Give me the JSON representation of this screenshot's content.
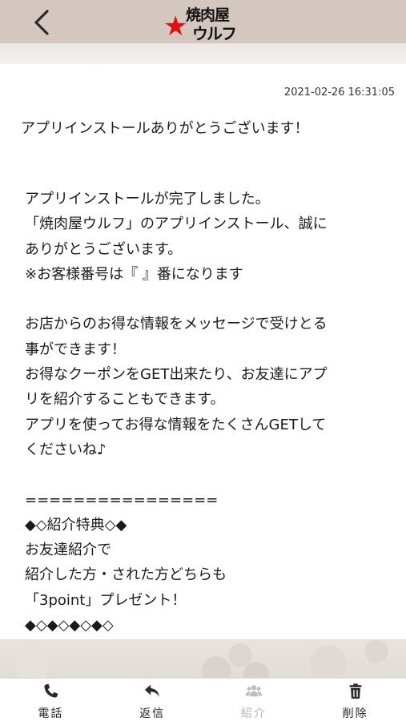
{
  "header": {
    "back_icon": "chevron-left-icon",
    "logo_top": "焼肉屋",
    "logo_bottom": "ウルフ",
    "logo_star": "★",
    "background": "#d4c7bf",
    "star_color": "#e01010"
  },
  "message": {
    "timestamp": "2021-02-26 16:31:05",
    "subject": "アプリインストールありがとうございます！",
    "lines": [
      "アプリインストールが完了しました。",
      "「焼肉屋ウルフ」のアプリインストール、誠に",
      "ありがとうございます。",
      "※お客様番号は『 』番になります",
      "",
      "お店からのお得な情報をメッセージで受けとる",
      "事ができます！",
      "お得なクーポンをGET出来たり、お友達にアプ",
      "リを紹介することもできます。",
      "アプリを使ってお得な情報をたくさんGETして",
      "くださいね♪",
      "",
      "================",
      "◆◇紹介特典◇◆",
      "お友達紹介で",
      "紹介した方・された方どちらも",
      "「3point」プレゼント！",
      "◆◇◆◇◆◇◆◇"
    ]
  },
  "nav": {
    "items": [
      {
        "label": "電話",
        "icon": "phone-icon",
        "enabled": true
      },
      {
        "label": "返信",
        "icon": "reply-icon",
        "enabled": true
      },
      {
        "label": "紹介",
        "icon": "users-icon",
        "enabled": false
      },
      {
        "label": "削除",
        "icon": "trash-icon",
        "enabled": true
      }
    ]
  }
}
